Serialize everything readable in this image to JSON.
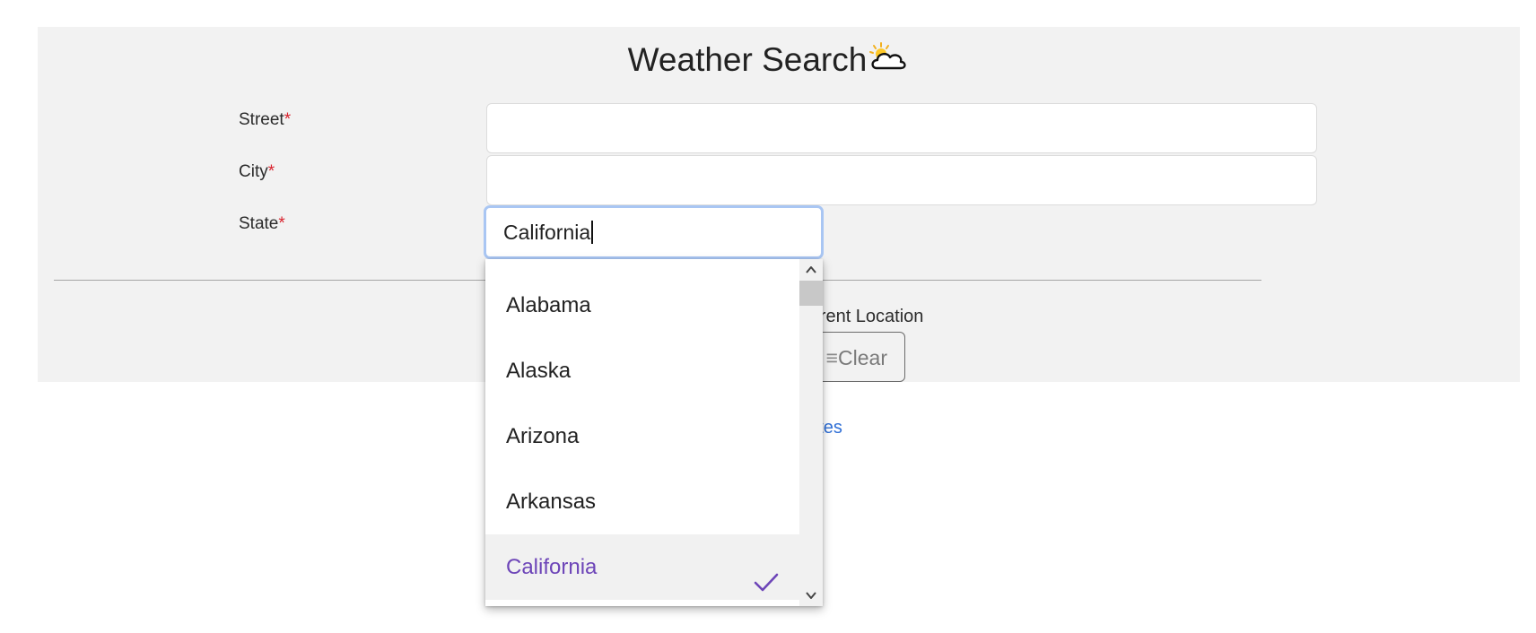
{
  "header": {
    "title": "Weather Search",
    "icon": "sun-cloud-icon"
  },
  "form": {
    "street": {
      "label": "Street",
      "required_mark": "*",
      "value": ""
    },
    "city": {
      "label": "City",
      "required_mark": "*",
      "value": ""
    },
    "state": {
      "label": "State",
      "required_mark": "*",
      "value": "California"
    }
  },
  "actions": {
    "location_text": "urrent Location",
    "clear_label": "Clear",
    "favorites_text": "orites"
  },
  "dropdown": {
    "options": [
      "Alabama",
      "Alaska",
      "Arizona",
      "Arkansas",
      "California"
    ],
    "selected": "California"
  },
  "colors": {
    "accent": "#6d45b8",
    "required": "#d9232e",
    "link": "#2f6fd6",
    "focus_border": "#a9c6f3"
  }
}
